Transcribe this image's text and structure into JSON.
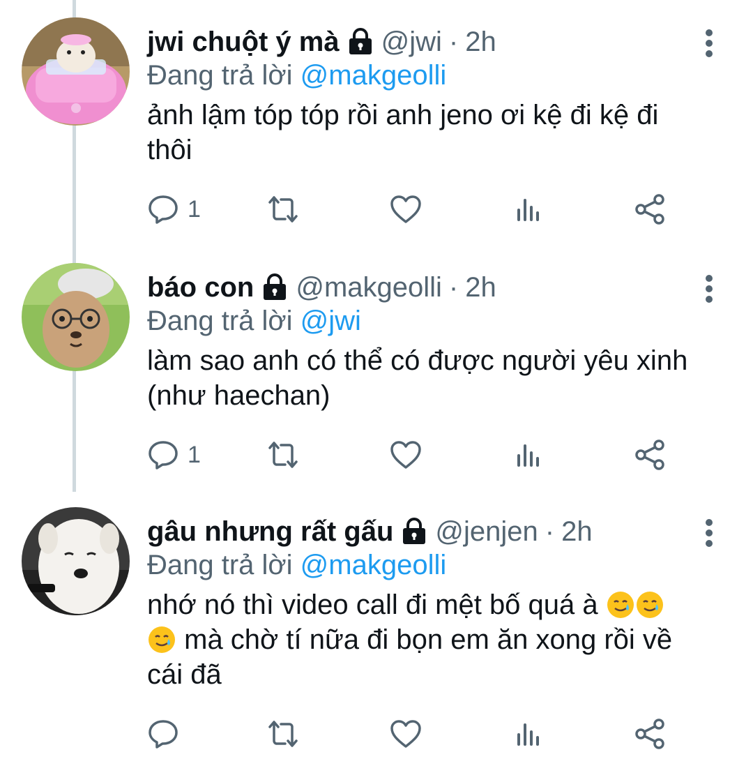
{
  "tweets": [
    {
      "name": "jwi chuột ý mà",
      "handle": "@jwi",
      "dot": "·",
      "time": "2h",
      "replying_prefix": "Đang trả lời",
      "replying_to": "@makgeolli",
      "body_lines": [
        "ảnh lậm tóp tóp rồi anh jeno ơi kệ đi kệ đi",
        "thôi"
      ],
      "reply_count": "1",
      "avatar_colors": {
        "bg": "#c9b48a",
        "car": "#f08fd0",
        "fur": "#f3ebe0"
      }
    },
    {
      "name": "báo con",
      "handle": "@makgeolli",
      "dot": "·",
      "time": "2h",
      "replying_prefix": "Đang trả lời",
      "replying_to": "@jwi",
      "body_lines": [
        "làm sao anh có thể có được người yêu xinh",
        "(như haechan)"
      ],
      "reply_count": "1",
      "avatar_colors": {
        "bg": "#8fbf5a",
        "fur": "#c9a27a",
        "hat": "#e6e6e6"
      }
    },
    {
      "name": "gâu nhưng rất gấu",
      "handle": "@jenjen",
      "dot": "·",
      "time": "2h",
      "replying_prefix": "Đang trả lời",
      "replying_to": "@makgeolli",
      "body_line1": "nhớ nó thì video call đi mệt bố quá à",
      "body_line2": "mà chờ tí nữa đi bọn em ăn xong rồi về",
      "body_line3": "cái đã",
      "emoji": "smiling-face-with-tear",
      "reply_count": "",
      "avatar_colors": {
        "bg": "#3a3a3a",
        "fur": "#f4f2ee"
      }
    }
  ],
  "icons": {
    "lock": "lock-icon",
    "reply": "reply-icon",
    "retweet": "retweet-icon",
    "like": "heart-icon",
    "views": "views-icon",
    "share": "share-icon",
    "more": "more-vertical-icon"
  },
  "colors": {
    "accent": "#1d9bf0",
    "secondary": "#536471",
    "text": "#0f1419",
    "thread_line": "#cfd9de"
  }
}
